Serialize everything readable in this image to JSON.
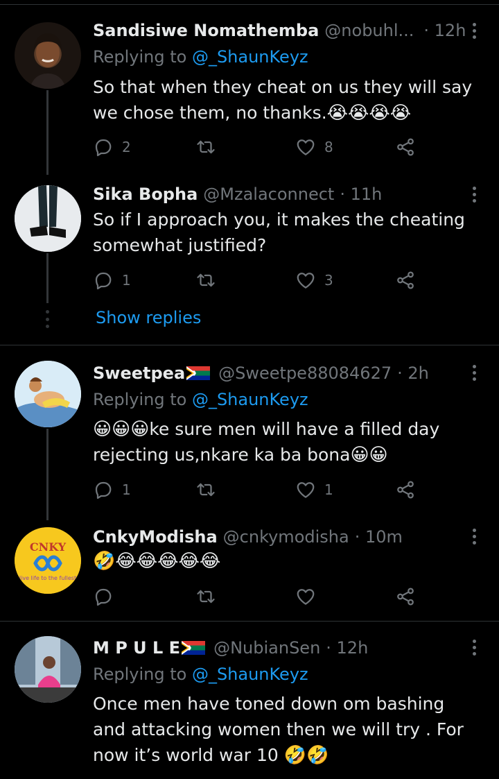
{
  "tweets": [
    {
      "name": "Sandisiwe Nomathemba",
      "handle": "@nobuhl...",
      "time": "· 12h",
      "replying_prefix": "Replying to ",
      "replying_to": "@_ShaunKeyz",
      "text": "So that when they cheat on us they will say we chose them, no thanks.",
      "text_emoji": "😭😭😭😭",
      "replies": "2",
      "retweets": "",
      "likes": "8"
    },
    {
      "name": "Sika Bopha",
      "handle": "@Mzalaconnect",
      "time": "· 11h",
      "text": "So if I approach you, it makes the cheating somewhat justified?",
      "replies": "1",
      "retweets": "",
      "likes": "3",
      "show_replies": "Show replies"
    },
    {
      "name": "Sweetpea",
      "handle": "@Sweetpe88084627",
      "time": "· 2h",
      "replying_prefix": "Replying to ",
      "replying_to": "@_ShaunKeyz",
      "text_emoji_lead": "😀😀😀",
      "text": "ke sure men will have a filled day rejecting us,nkare ka ba bona",
      "text_emoji": "😀😀",
      "replies": "1",
      "retweets": "",
      "likes": "1"
    },
    {
      "name": "CnkyModisha",
      "handle": "@cnkymodisha",
      "time": "· 10m",
      "text_emoji": "🤣😂😂😂😂😂",
      "replies": "",
      "retweets": "",
      "likes": "",
      "avatar_logo_text": "CNKY",
      "avatar_tagline": "live life to the fullest"
    },
    {
      "name": "M P U L E",
      "handle": "@NubianSen",
      "time": "· 12h",
      "replying_prefix": "Replying to ",
      "replying_to": "@_ShaunKeyz",
      "text": "Once men have toned down om bashing and attacking women then we will try . For now it’s world war 10 ",
      "text_emoji": "🤣🤣"
    }
  ],
  "colors": {
    "background": "#000000",
    "text": "#e7e9ea",
    "secondary": "#71767b",
    "accent": "#1d9bf0",
    "divider": "#2f3336"
  },
  "icons": [
    "reply-icon",
    "retweet-icon",
    "like-icon",
    "share-icon",
    "more-icon",
    "south-africa-flag-icon"
  ]
}
